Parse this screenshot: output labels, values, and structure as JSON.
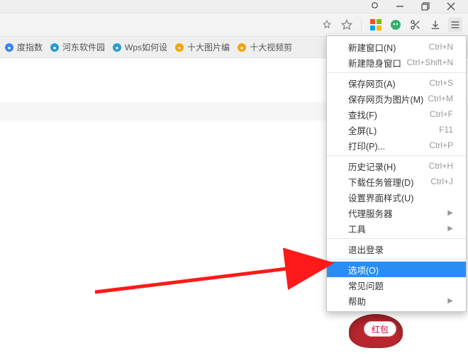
{
  "titlebar": {
    "extension_icon": "puzzle-icon",
    "minimize": "min",
    "restore": "restore",
    "close": "close"
  },
  "toolbar": {
    "pin_icon": "pin-icon",
    "star_icon": "star-icon",
    "ms_icon": "microsoft-icon",
    "assist_icon": "assistant-icon",
    "cut_icon": "scissors-icon",
    "download_icon": "download-icon",
    "menu_icon": "hamburger-icon"
  },
  "bookmarks": [
    {
      "label": "度指数",
      "color": "#3b82f6"
    },
    {
      "label": "河东软件园",
      "color": "#2a9bd6"
    },
    {
      "label": "Wps如何设",
      "color": "#2a9bd6"
    },
    {
      "label": "十大图片编",
      "color": "#f6a400"
    },
    {
      "label": "十大视频剪",
      "color": "#f6a400"
    }
  ],
  "menu": {
    "groups": [
      [
        {
          "label": "新建窗口(N)",
          "shortcut": "Ctrl+N",
          "sub": false
        },
        {
          "label": "新建隐身窗口",
          "shortcut": "Ctrl+Shift+N",
          "sub": false
        }
      ],
      [
        {
          "label": "保存网页(A)",
          "shortcut": "Ctrl+S",
          "sub": false
        },
        {
          "label": "保存网页为图片(M)",
          "shortcut": "Ctrl+M",
          "sub": false
        },
        {
          "label": "查找(F)",
          "shortcut": "Ctrl+F",
          "sub": false
        },
        {
          "label": "全屏(L)",
          "shortcut": "F11",
          "sub": false
        },
        {
          "label": "打印(P)...",
          "shortcut": "Ctrl+P",
          "sub": false
        }
      ],
      [
        {
          "label": "历史记录(H)",
          "shortcut": "Ctrl+H",
          "sub": false
        },
        {
          "label": "下载任务管理(D)",
          "shortcut": "Ctrl+J",
          "sub": false
        },
        {
          "label": "设置界面样式(U)",
          "shortcut": "",
          "sub": false
        },
        {
          "label": "代理服务器",
          "shortcut": "",
          "sub": true
        },
        {
          "label": "工具",
          "shortcut": "",
          "sub": true
        }
      ],
      [
        {
          "label": "退出登录",
          "shortcut": "",
          "sub": false
        }
      ],
      [
        {
          "label": "选项(O)",
          "shortcut": "",
          "sub": false,
          "selected": true
        },
        {
          "label": "常见问题",
          "shortcut": "",
          "sub": false
        },
        {
          "label": "帮助",
          "shortcut": "",
          "sub": true
        }
      ]
    ]
  },
  "redbag": {
    "label": "红包"
  }
}
